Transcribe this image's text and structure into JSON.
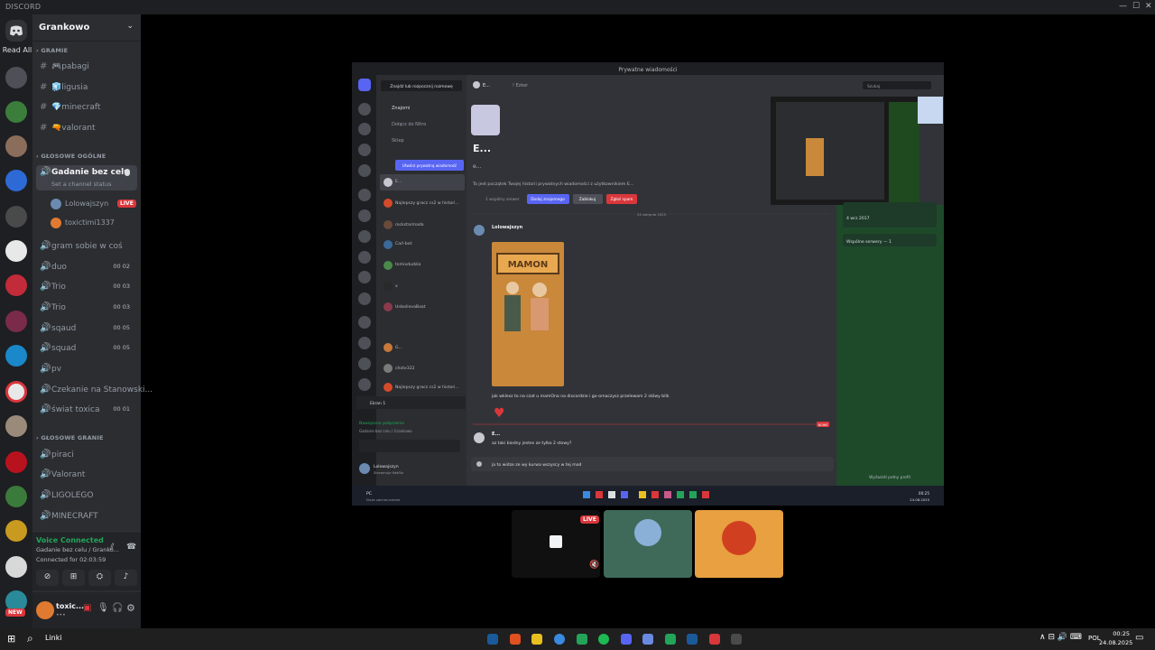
{
  "window": {
    "title": "DISCORD"
  },
  "rail": {
    "read_all": "Read All",
    "new_badge": "NEW"
  },
  "guild": {
    "name": "Grankowo"
  },
  "categories": {
    "gramie": "GRAMIE",
    "glosowe_ogolne": "GŁOSOWE OGÓLNE",
    "glosowe_granie": "GŁOSOWE GRANIE"
  },
  "text_channels": [
    {
      "label": "🎮pabagi"
    },
    {
      "label": "🧊ligusia"
    },
    {
      "label": "💎minecraft"
    },
    {
      "label": "🔫valorant"
    }
  ],
  "active_voice": {
    "label": "Gadanie bez celu",
    "status": "Set a channel status",
    "users": [
      {
        "name": "Lolowajszyn",
        "live": "LIVE"
      },
      {
        "name": "toxictimi1337"
      }
    ]
  },
  "voice_channels": [
    {
      "label": "gram sobie w coś",
      "count": ""
    },
    {
      "label": "duo",
      "count": "00  02"
    },
    {
      "label": "Trio",
      "count": "00  03"
    },
    {
      "label": "Trio",
      "count": "00  03"
    },
    {
      "label": "sqaud",
      "count": "00  05"
    },
    {
      "label": "squad",
      "count": "00  05"
    },
    {
      "label": "pv",
      "count": ""
    },
    {
      "label": "Czekanie na Stanowski...",
      "count": ""
    },
    {
      "label": "świat toxica",
      "count": "00  01"
    }
  ],
  "game_channels": [
    {
      "label": "piraci"
    },
    {
      "label": "Valorant"
    },
    {
      "label": "LIGOLEGO"
    },
    {
      "label": "MINECRAFT"
    }
  ],
  "voice_status": {
    "title": "Voice Connected",
    "channel": "Gadanie bez celu / Granko...",
    "time": "Connected for 02:03:59"
  },
  "user": {
    "name": "toxic...",
    "sub": "•••"
  },
  "shared_screen": {
    "title": "Prywatne wiadomości",
    "search_btn": "Znajdź lub rozpocznij rozmowę",
    "nav": [
      "Znajomi",
      "Dołącz do Nitro",
      "Sklep"
    ],
    "open_dm": "Utwórz prywatną wiadomość",
    "dm_list": [
      "E...",
      "Najlepszy gracz cs2 w histori...",
      "rockstarmada",
      "Carl-bot",
      "tomixdudzia",
      "x",
      "UnbelievaBoat",
      "G...",
      "chotx322",
      "Najlepszy gracz cs2 w histori..."
    ],
    "screen_label": "Ekran 1",
    "connection": "Nawiązano połączenie",
    "connection_sub": "Gadanie bez celu / Grankowo",
    "self_name": "Lolowajszyn",
    "self_sub": "Streamuje Netflix",
    "header_user": "E...",
    "header_tag": "! Ezker",
    "profile_name": "E...",
    "profile_sub": "e...",
    "intro": "To jest początek Twojej historii prywatnych wiadomości z użytkownikiem E...",
    "mutual": "1 wspólny serwer",
    "add_friend": "Dodaj znajomego",
    "block": "Zablokuj",
    "report": "Zgłoś spam",
    "date": "24 sierpnia 2025",
    "msg_author": "Lolowajszyn",
    "meme_title": "MAMON",
    "msg_text": "jak wklesz to na czat u mamOna na discordzie i go-omaczysz przelewam 2 stówy blik",
    "heart": "♥",
    "reply_author": "E...",
    "reply_text": "az taki biedny jestes ze tylko 2 stowy?",
    "new_label": "NOWE",
    "input_text": "ja to widze ze wy kurwa wszyscy w tej mod",
    "top_search": "Szukaj",
    "member_since": "4 wrz 2017",
    "mutual_servers": "Wspólne serwery — 1",
    "view_profile": "Wyświetl pełny profil",
    "tb_time": "00:25",
    "tb_date": "24.08.2025",
    "tb_app": "PC",
    "tb_app_sub": "Duże zachmurzenie"
  },
  "thumbnails": {
    "live": "LIVE"
  },
  "taskbar": {
    "search": "Linki",
    "lang": "POL",
    "time": "00:25",
    "date": "24.08.2025"
  },
  "colors": {
    "accent": "#5865f2",
    "live": "#da373c",
    "online": "#23a559"
  }
}
